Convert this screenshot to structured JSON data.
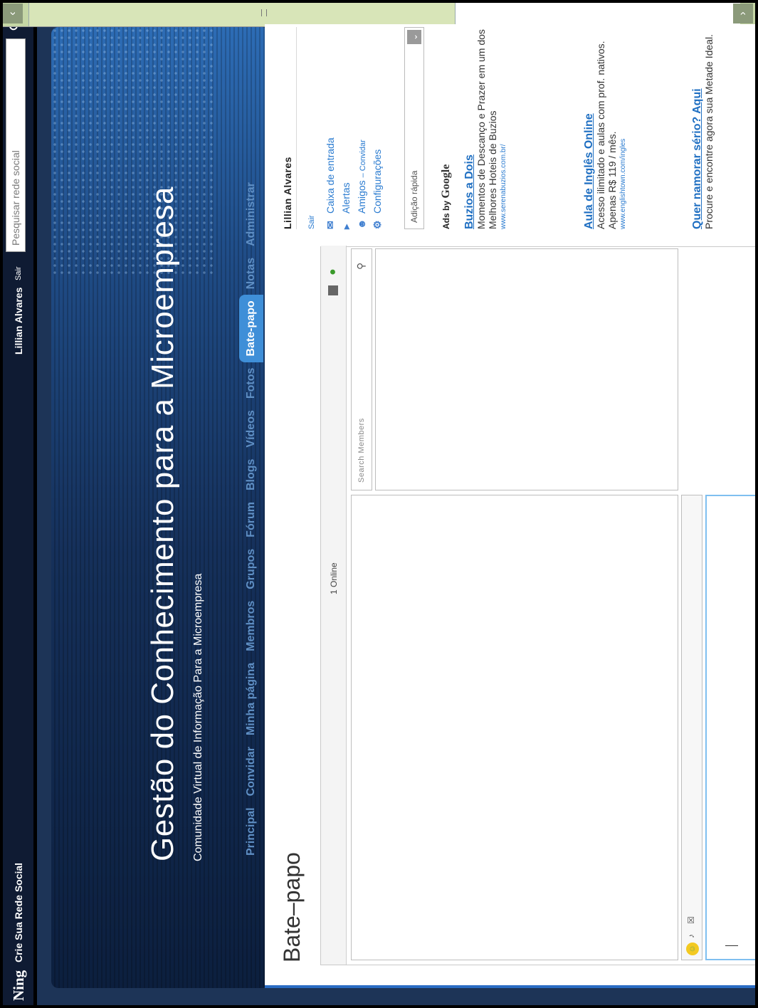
{
  "topbar": {
    "logo": "Ning",
    "create_network": "Crie Sua Rede Social",
    "user_name": "Lillian Alvares",
    "signout": "Sair",
    "search_placeholder": "Pesquisar rede social",
    "search_icon": "search-icon"
  },
  "banner": {
    "title": "Gestão do Conhecimento para a Microempresa",
    "subtitle": "Comunidade Virtual de Informação Para a Microempresa"
  },
  "nav": {
    "items": [
      {
        "label": "Principal"
      },
      {
        "label": "Convidar"
      },
      {
        "label": "Minha página"
      },
      {
        "label": "Membros"
      },
      {
        "label": "Grupos"
      },
      {
        "label": "Fórum"
      },
      {
        "label": "Blogs"
      },
      {
        "label": "Vídeos"
      },
      {
        "label": "Fotos"
      },
      {
        "label": "Bate-papo"
      },
      {
        "label": "Notas"
      },
      {
        "label": "Administrar"
      }
    ],
    "active": "Bate-papo"
  },
  "page": {
    "title": "Bate–papo"
  },
  "chat": {
    "online_count": "1 Online",
    "search_members_placeholder": "Search Members"
  },
  "sidebar": {
    "user_name": "Lillian Alvares",
    "signout": "Sair",
    "links": {
      "inbox": "Caixa de entrada",
      "alerts": "Alertas",
      "friends": "Amigos",
      "invite": "– Convidar",
      "settings": "Configurações"
    },
    "quick_add": "Adição rápida",
    "ads_by": "Ads by",
    "ads_brand": "Google",
    "ads": [
      {
        "title": "Buzios a Dois",
        "text": "Momentos de Descanço e Prazer em um dos Melhores Hoteis de Buzios",
        "url": "www.serenabuzios.com.br/"
      },
      {
        "title": "Aula de Inglês Online",
        "text": "Acesso ilimitado e aulas com prof. nativos. Apenas R$ 119 / mês.",
        "url": "www.englishtown.com/ingles"
      },
      {
        "title": "Quer namorar sério? Aqui",
        "text": "Procure e encontre agora sua Metade Ideal.",
        "url": ""
      }
    ]
  },
  "colors": {
    "accent": "#3f8fd8",
    "link": "#2a7bd0",
    "banner_dark": "#0c1f3e"
  }
}
